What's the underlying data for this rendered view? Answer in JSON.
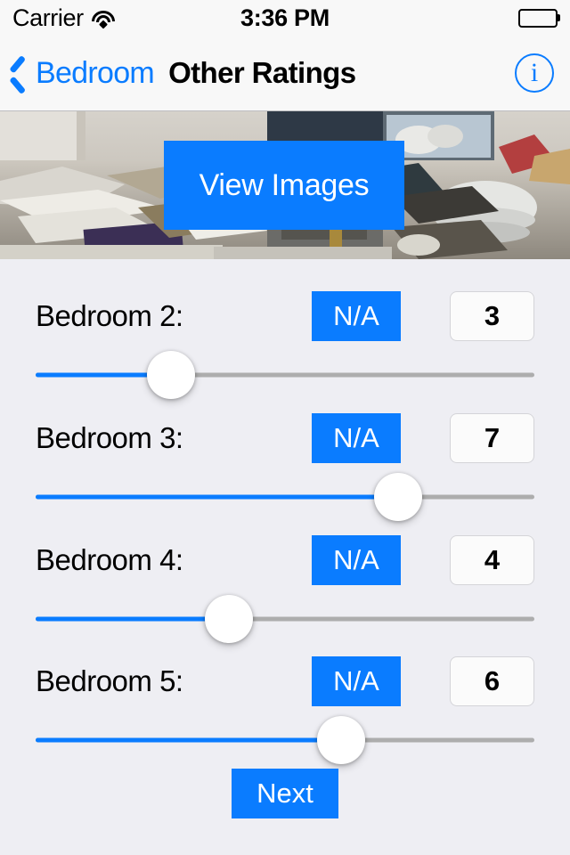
{
  "status_bar": {
    "carrier": "Carrier",
    "time": "3:36 PM",
    "wifi_icon": "wifi-icon",
    "battery_icon": "battery-full-icon"
  },
  "nav_bar": {
    "back_label": "Bedroom",
    "back_icon": "chevron-left-icon",
    "title": "Other Ratings",
    "info_icon": "info-circle-icon",
    "info_glyph": "i"
  },
  "banner": {
    "view_images_label": "View Images",
    "photo_description": "cluttered-room-photo"
  },
  "ratings": {
    "na_label": "N/A",
    "rows": [
      {
        "label": "Bedroom 2:",
        "value": "3",
        "slider_percent": 27
      },
      {
        "label": "Bedroom 3:",
        "value": "7",
        "slider_percent": 73
      },
      {
        "label": "Bedroom 4:",
        "value": "4",
        "slider_percent": 39
      },
      {
        "label": "Bedroom 5:",
        "value": "6",
        "slider_percent": 61
      }
    ]
  },
  "footer": {
    "next_label": "Next"
  },
  "colors": {
    "accent_blue": "#0a7cff",
    "page_background": "#eeeef3",
    "bar_background": "#f8f8f8",
    "slider_track": "#adadad"
  }
}
